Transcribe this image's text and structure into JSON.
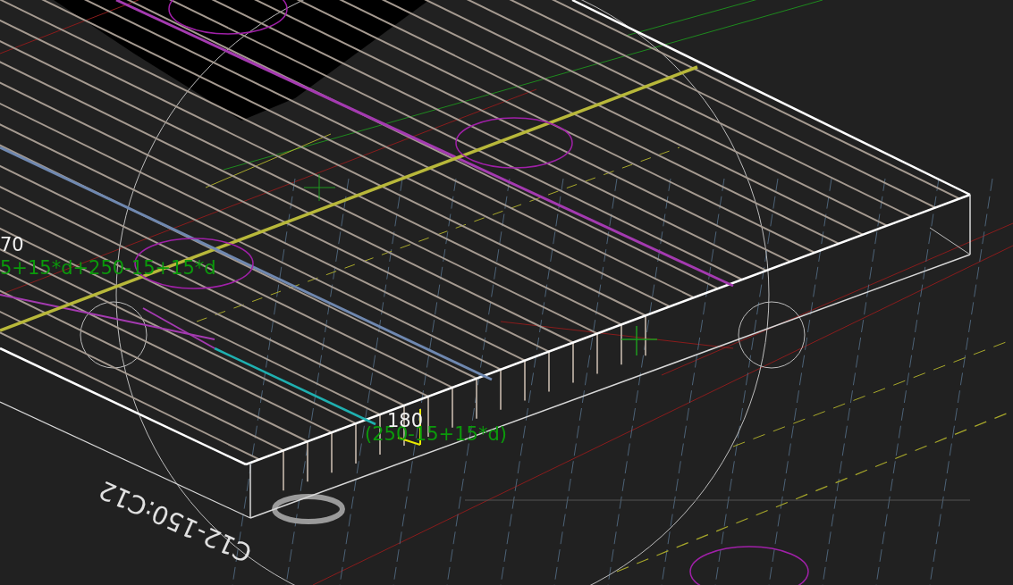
{
  "viewport": {
    "labels": [
      {
        "kind": "value",
        "text": "70"
      },
      {
        "kind": "formula",
        "text": "5+15*d+250-15+15*d"
      },
      {
        "kind": "value",
        "text": "180"
      },
      {
        "kind": "formula",
        "text": "(250-15+15*d)"
      },
      {
        "kind": "callout",
        "text": "C12-150:C12"
      }
    ]
  }
}
